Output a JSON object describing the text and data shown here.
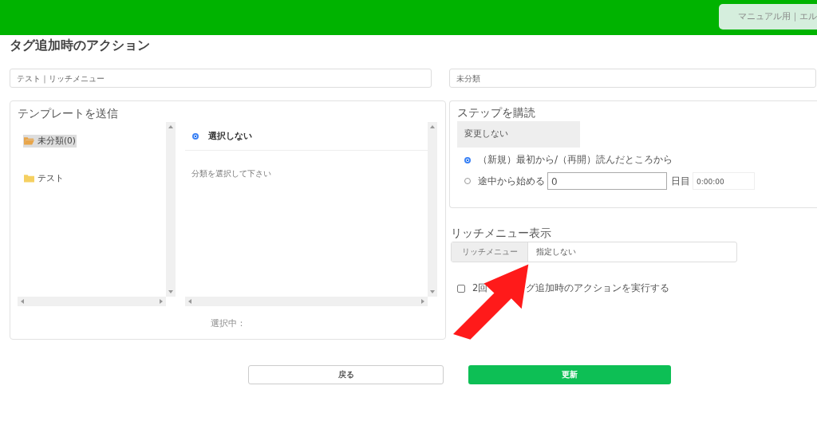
{
  "header": {
    "account": "マニュアル用｜エル"
  },
  "title": "タグ追加時のアクション",
  "tag_field": {
    "value": "テスト｜リッチメニュー"
  },
  "category_field": {
    "value": "未分類"
  },
  "template": {
    "heading": "テンプレートを送信",
    "folders": [
      {
        "label": "未分類(0)",
        "selected": true
      },
      {
        "label": "テスト",
        "selected": false
      }
    ],
    "options": [
      {
        "label": "選択しない",
        "selected": true
      }
    ],
    "hint": "分類を選択して下さい",
    "selection_label": "選択中："
  },
  "step": {
    "heading": "ステップを購読",
    "dropdown": "変更しない",
    "options": [
      {
        "label": "（新規）最初から/（再開）読んだところから",
        "selected": true,
        "kind": "plain"
      },
      {
        "label": "途中から始める",
        "selected": false,
        "kind": "day",
        "day": "0",
        "unit": "日目",
        "time": "0:00:00"
      }
    ]
  },
  "rich_menu": {
    "heading": "リッチメニュー表示",
    "addon": "リッチメニュー",
    "value": "指定しない"
  },
  "repeat_option": {
    "label_start": "2回",
    "label_end": "グ追加時のアクションを実行する",
    "checked": false
  },
  "buttons": [
    {
      "label": "戻る",
      "kind": "secondary"
    },
    {
      "label": "更新",
      "kind": "primary"
    }
  ]
}
